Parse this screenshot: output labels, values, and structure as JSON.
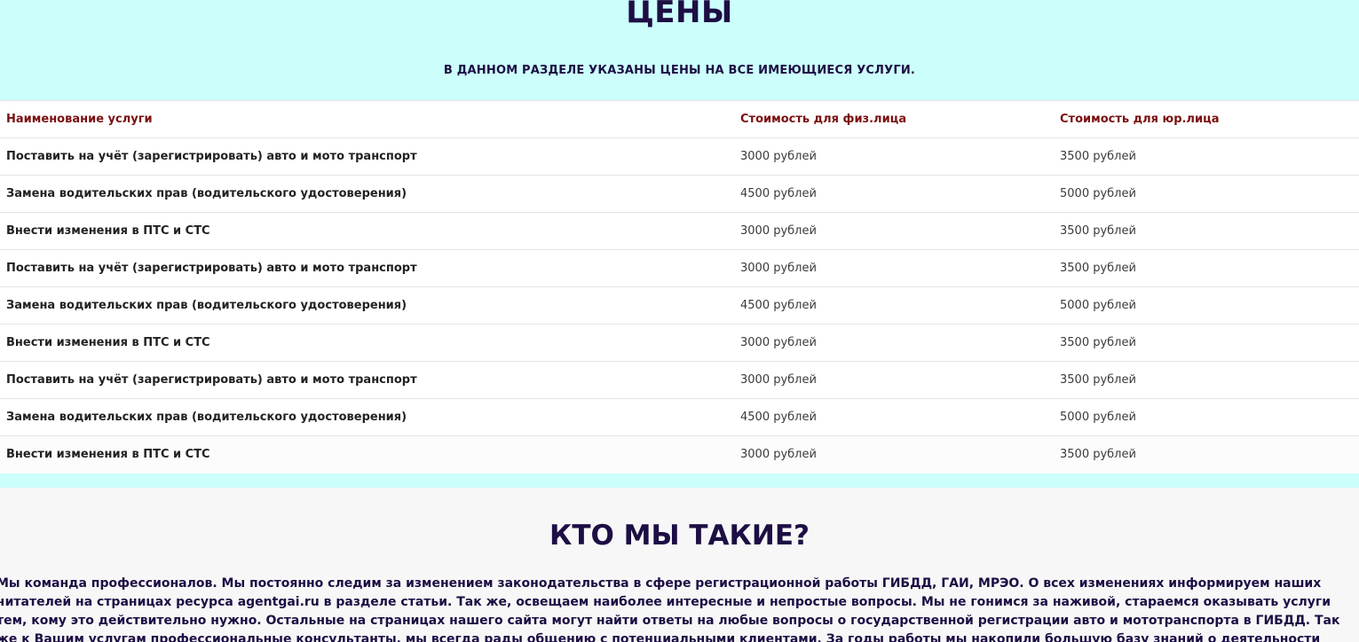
{
  "prices": {
    "title": "ЦЕНЫ",
    "subtitle": "В ДАННОМ РАЗДЕЛЕ УКАЗАНЫ ЦЕНЫ НА ВСЕ ИМЕЮЩИЕСЯ УСЛУГИ.",
    "columns": [
      "Наименование услуги",
      "Стоимость для физ.лица",
      "Стоимость для юр.лица"
    ],
    "rows": [
      [
        "Поставить на учёт (зарегистрировать) авто и мото транспорт",
        "3000 рублей",
        "3500 рублей"
      ],
      [
        "Замена водительских прав (водительского удостоверения)",
        "4500 рублей",
        "5000 рублей"
      ],
      [
        "Внести изменения в ПТС и СТС",
        "3000 рублей",
        "3500 рублей"
      ],
      [
        "Поставить на учёт (зарегистрировать) авто и мото транспорт",
        "3000 рублей",
        "3500 рублей"
      ],
      [
        "Замена водительских прав (водительского удостоверения)",
        "4500 рублей",
        "5000 рублей"
      ],
      [
        "Внести изменения в ПТС и СТС",
        "3000 рублей",
        "3500 рублей"
      ],
      [
        "Поставить на учёт (зарегистрировать) авто и мото транспорт",
        "3000 рублей",
        "3500 рублей"
      ],
      [
        "Замена водительских прав (водительского удостоверения)",
        "4500 рублей",
        "5000 рублей"
      ],
      [
        "Внести изменения в ПТС и СТС",
        "3000 рублей",
        "3500 рублей"
      ]
    ]
  },
  "about": {
    "title": "КТО МЫ ТАКИЕ?",
    "text": "Мы команда профессионалов. Мы постоянно следим за изменением законодательства в сфере регистрационной работы ГИБДД, ГАИ, МРЭО. О всех изменениях информируем наших читателей на страницах ресурса agentgai.ru в разделе статьи. Так же, освещаем наиболее интересные и непростые вопросы. Мы не гонимся за наживой, стараемся оказывать услуги тем, кому это действительно нужно. Остальные на страницах нашего сайта могут найти ответы на любые вопросы о государственной регистрации авто и мототранспорта в ГИБДД. Так же к Вашим услугам профессиональные консультанты, мы всегда рады общению с потенциальными клиентами. За годы работы мы накопили большую базу знаний о деятельности всех отделений МРЭО ГИБДД (межрайонного регистрационно-экзаменационного отдела государственной инспекции безопасности"
  },
  "colors": {
    "prices_bg": "#ccfffb",
    "heading": "#1d0e44",
    "table_header": "#7a1010",
    "about_bg": "#f7f7f7"
  }
}
